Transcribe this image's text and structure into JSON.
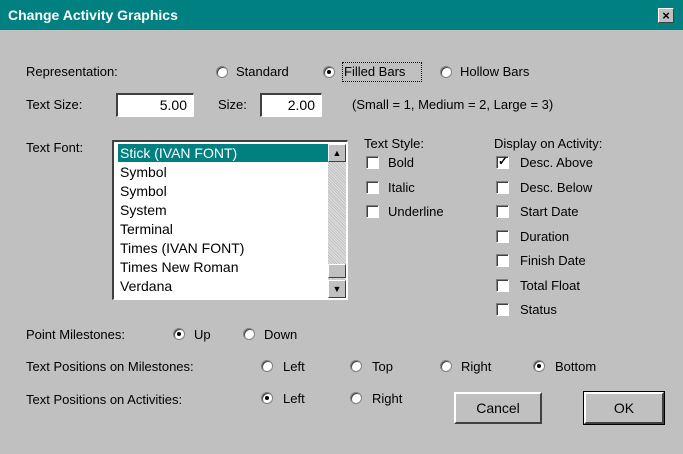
{
  "window": {
    "title": "Change Activity Graphics",
    "close_label": "×"
  },
  "representation": {
    "label": "Representation:",
    "options": [
      "Standard",
      "Filled Bars",
      "Hollow Bars"
    ],
    "selected": "Filled Bars"
  },
  "text_size": {
    "label": "Text Size:",
    "value": "5.00"
  },
  "size": {
    "label": "Size:",
    "value": "2.00",
    "hint": "(Small = 1, Medium = 2, Large = 3)"
  },
  "text_font": {
    "label": "Text Font:",
    "items": [
      "Stick (IVAN FONT)",
      "Symbol",
      "Symbol",
      "System",
      "Terminal",
      "Times (IVAN FONT)",
      "Times New Roman",
      "Verdana"
    ],
    "selected": "Stick (IVAN FONT)"
  },
  "text_style": {
    "label": "Text Style:",
    "options": [
      {
        "label": "Bold",
        "checked": false
      },
      {
        "label": "Italic",
        "checked": false
      },
      {
        "label": "Underline",
        "checked": false
      }
    ]
  },
  "display_on_activity": {
    "label": "Display on Activity:",
    "options": [
      {
        "label": "Desc. Above",
        "checked": true
      },
      {
        "label": "Desc. Below",
        "checked": false
      },
      {
        "label": "Start Date",
        "checked": false
      },
      {
        "label": "Duration",
        "checked": false
      },
      {
        "label": "Finish Date",
        "checked": false
      },
      {
        "label": "Total Float",
        "checked": false
      },
      {
        "label": "Status",
        "checked": false
      }
    ]
  },
  "point_milestones": {
    "label": "Point Milestones:",
    "options": [
      "Up",
      "Down"
    ],
    "selected": "Up"
  },
  "text_positions_milestones": {
    "label": "Text Positions on Milestones:",
    "options": [
      "Left",
      "Top",
      "Right",
      "Bottom"
    ],
    "selected": "Bottom"
  },
  "text_positions_activities": {
    "label": "Text Positions on Activities:",
    "options": [
      "Left",
      "Right"
    ],
    "selected": "Left"
  },
  "buttons": {
    "cancel": "Cancel",
    "ok": "OK"
  }
}
